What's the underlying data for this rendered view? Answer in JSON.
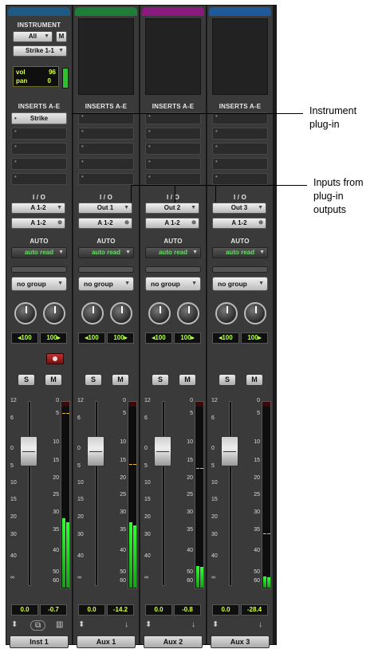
{
  "strips": [
    {
      "color": "#1e5a86",
      "inserts_header": "INSERTS A-E",
      "plugin": "Strike",
      "io_header": "I / O",
      "input": "A 1-2",
      "output": "A 1-2",
      "auto_header": "AUTO",
      "auto_mode": "auto read",
      "group": "no group",
      "pan_l": "◂100",
      "pan_r": "100▸",
      "solo": "S",
      "mute": "M",
      "vol": "0.0",
      "peak": "-0.7",
      "name": "Inst 1",
      "meter_level": 0.38,
      "peak_level": 0.96
    },
    {
      "color": "#1f7d3a",
      "inserts_header": "INSERTS A-E",
      "io_header": "I / O",
      "input": "Out 1",
      "output": "A 1-2",
      "auto_header": "AUTO",
      "auto_mode": "auto read",
      "group": "no group",
      "pan_l": "◂100",
      "pan_r": "100▸",
      "solo": "S",
      "mute": "M",
      "vol": "0.0",
      "peak": "-14.2",
      "name": "Aux 1",
      "meter_level": 0.36,
      "peak_level": 0.68
    },
    {
      "color": "#8a1a7e",
      "inserts_header": "INSERTS A-E",
      "io_header": "I / O",
      "input": "Out 2",
      "output": "A 1-2",
      "auto_header": "AUTO",
      "auto_mode": "auto read",
      "group": "no group",
      "pan_l": "◂100",
      "pan_r": "100▸",
      "solo": "S",
      "mute": "M",
      "vol": "0.0",
      "peak": "-0.8",
      "name": "Aux 2",
      "meter_level": 0.12,
      "peak_level": 0.66
    },
    {
      "color": "#1e5a9a",
      "inserts_header": "INSERTS A-E",
      "io_header": "I / O",
      "input": "Out 3",
      "output": "A 1-2",
      "auto_header": "AUTO",
      "auto_mode": "auto read",
      "group": "no group",
      "pan_l": "◂100",
      "pan_r": "100▸",
      "solo": "S",
      "mute": "M",
      "vol": "0.0",
      "peak": "-28.4",
      "name": "Aux 3",
      "meter_level": 0.06,
      "peak_level": 0.3
    }
  ],
  "instrument": {
    "header": "INSTRUMENT",
    "filter": "All",
    "midi_btn": "M",
    "patch": "Strike 1-1",
    "vol_label": "vol",
    "vol_value": "96",
    "pan_label": "pan",
    "pan_value": "0"
  },
  "fader_scale": [
    "12",
    "6",
    "0",
    "5",
    "10",
    "15",
    "20",
    "30",
    "40",
    "∞"
  ],
  "meter_scale": [
    "0",
    "5",
    "10",
    "15",
    "20",
    "25",
    "30",
    "35",
    "40",
    "50",
    "60"
  ],
  "callouts": {
    "instrument_plugin": "Instrument\nplug-in",
    "inputs_from_plugin": "Inputs from\nplug-in\noutputs"
  }
}
